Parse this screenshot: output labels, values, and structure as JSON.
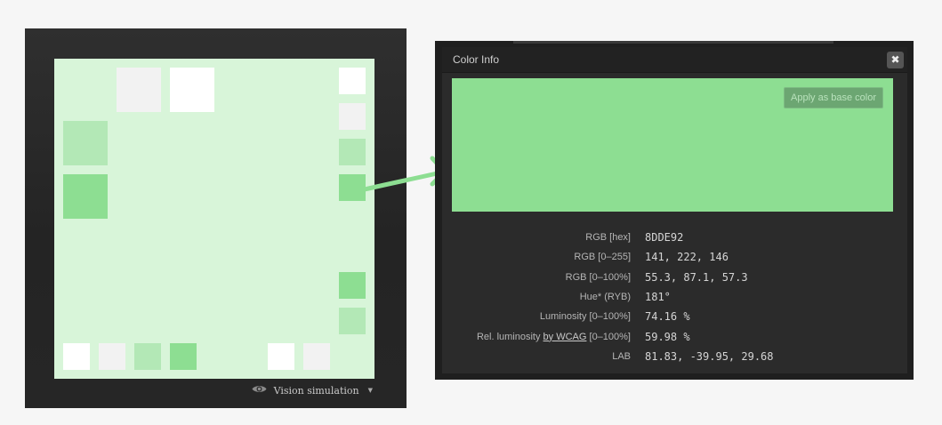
{
  "preview": {
    "background": "#d8f5d9",
    "swatch_colors": [
      "#f2f2f2",
      "#ffffff",
      "#b3e8b6",
      "#8dde92"
    ],
    "vision_label": "Vision simulation",
    "vision_icon": "eye-icon",
    "dropdown_icon": "caret-down-icon"
  },
  "dialog": {
    "title": "Color Info",
    "close_icon": "close-icon",
    "close_glyph": "✖",
    "swatch_color": "#8dde92",
    "apply_label": "Apply as base color",
    "rows": [
      {
        "label": "RGB [hex]",
        "value": "8DDE92"
      },
      {
        "label": "RGB [0–255]",
        "value": "141, 222, 146"
      },
      {
        "label": "RGB [0–100%]",
        "value": "55.3, 87.1, 57.3"
      },
      {
        "label": "Hue* (RYB)",
        "value": "181°"
      },
      {
        "label": "Luminosity [0–100%]",
        "value": "74.16 %"
      },
      {
        "label_prefix": "Rel. luminosity ",
        "label_link": "by WCAG",
        "label_suffix": " [0–100%]",
        "value": "59.98 %"
      },
      {
        "label": "LAB",
        "value": "81.83, -39.95, 29.68"
      }
    ]
  },
  "arrow_color": "#8dde92"
}
